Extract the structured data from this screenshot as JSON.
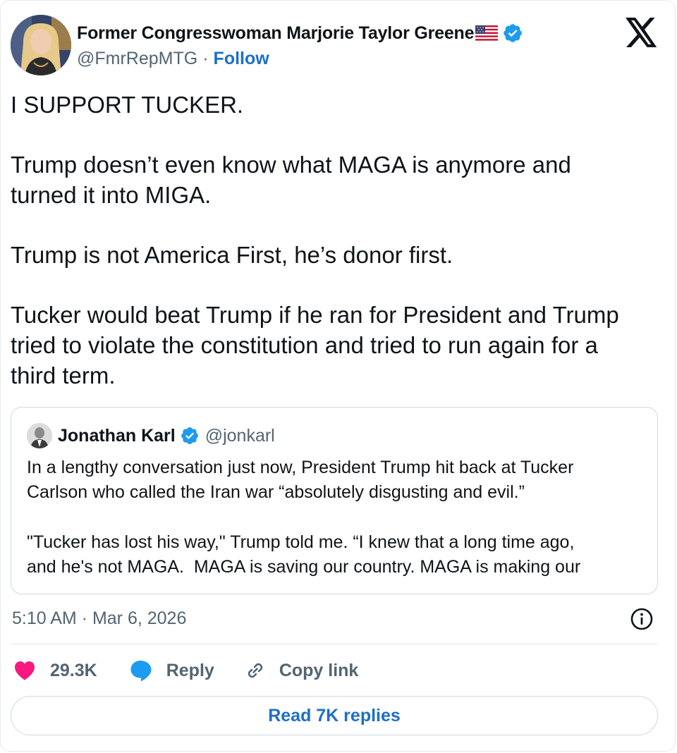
{
  "author": {
    "name": "Former Congresswoman Marjorie Taylor Greene",
    "flag_icon": "us-flag-icon",
    "verified_icon": "verified-badge-icon",
    "handle": "@FmrRepMTG",
    "separator": "·",
    "follow_label": "Follow"
  },
  "platform_logo": "x-logo-icon",
  "tweet": {
    "paragraphs": [
      "I SUPPORT TUCKER.",
      "Trump doesn’t even know what MAGA is anymore and\nturned it into MIGA.",
      "Trump is not America First, he’s donor first.",
      "Tucker would beat Trump if he ran for President and Trump\ntried to violate the constitution and tried to run again for a\nthird term."
    ]
  },
  "quote": {
    "name": "Jonathan Karl",
    "handle": "@jonkarl",
    "paragraphs": [
      "In a lengthy conversation just now, President Trump hit back at Tucker\nCarlson who called the Iran war “absolutely disgusting and evil.”",
      "\"Tucker has lost his way,\" Trump told me. “I knew that a long time ago,\nand he's not MAGA.  MAGA is saving our country. MAGA is making our"
    ]
  },
  "timestamp": "5:10 AM · Mar 6, 2026",
  "actions": {
    "likes": "29.3K",
    "reply_label": "Reply",
    "copy_link_label": "Copy link"
  },
  "read_replies_label": "Read 7K replies",
  "colors": {
    "accent": "#1d6fc9",
    "verified": "#1d9bf0",
    "like": "#f91880",
    "secondary_text": "#536471"
  }
}
